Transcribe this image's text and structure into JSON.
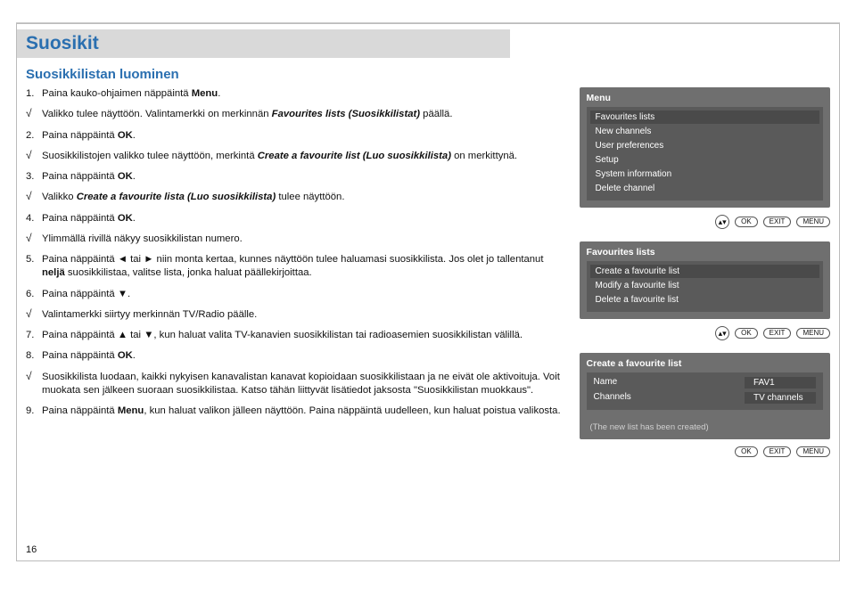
{
  "heading": "Suosikit",
  "section_title": "Suosikkilistan luominen",
  "steps": {
    "s1": {
      "num": "1.",
      "suffix": "."
    },
    "c1_prefix": "Valikko tulee näyttöön. Valintamerkki on merkinnän ",
    "c1_em": "Favourites lists (Suosikkilistat)",
    "c1_suffix": " päällä.",
    "s2": {
      "num": "2.",
      "suffix": "."
    },
    "c2_prefix": "Suosikkilistojen valikko tulee näyttöön, merkintä ",
    "c2_em": "Create a favourite list (Luo suosikkilista)",
    "c2_suffix": " on merkittynä.",
    "s3": {
      "num": "3.",
      "suffix": "."
    },
    "c3_prefix": "Valikko ",
    "c3_em": "Create a favourite lista (Luo suosikkilista)",
    "c3_suffix": " tulee näyttöön.",
    "s4": {
      "num": "4.",
      "suffix": "."
    },
    "c4": "Ylimmällä rivillä näkyy suosikkilistan numero.",
    "s5": {
      "num": "5."
    },
    "s5_text": " niin monta kertaa, kunnes näyttöön tulee haluamasi suosikkilista. Jos olet jo tallentanut ",
    "s5_em": "neljä",
    "s5_suffix": " suosikkilistaa, valitse lista, jonka haluat päällekirjoittaa.",
    "s6": {
      "num": "6.",
      "suffix": "."
    },
    "c6": "Valintamerkki siirtyy merkinnän TV/Radio päälle.",
    "s7": {
      "num": "7."
    },
    "s7_text": ", kun haluat valita TV-kanavien suosikkilistan tai radioasemien suosikkilistan välillä.",
    "s8": {
      "num": "8.",
      "suffix": "."
    },
    "c8": "Suosikkilista luodaan, kaikki nykyisen kanavalistan kanavat kopioidaan suosikkilistaan ja ne eivät ole aktivoituja. Voit muokata sen jälkeen suoraan suosikkilistaa. Katso tähän liittyvät lisätiedot jaksosta \"Suosikkilistan muokkaus\".",
    "s9": {
      "num": "9."
    },
    "s9_text": ", kun haluat valikon jälleen näyttöön. Paina näppäintä uudelleen, kun haluat poistua valikosta."
  },
  "labels": {
    "press_remote": "Paina kauko-ohjaimen näppäintä ",
    "press_btn": "Paina näppäintä ",
    "menu": "Menu",
    "ok": "OK",
    "tai": " tai ",
    "left": "◄",
    "right": "►",
    "up": "▲",
    "down": "▼",
    "exit": "EXIT",
    "menu_pill": "MENU",
    "updown": "▴▾"
  },
  "panel_menu": {
    "title": "Menu",
    "items": [
      "Favourites lists",
      "New channels",
      "User preferences",
      "Setup",
      "System information",
      "Delete channel"
    ]
  },
  "panel_fav": {
    "title": "Favourites lists",
    "items": [
      "Create a favourite list",
      "Modify a favourite list",
      "Delete a favourite list"
    ]
  },
  "panel_create": {
    "title": "Create a favourite list",
    "row_name_k": "Name",
    "row_name_v": "FAV1",
    "row_ch_k": "Channels",
    "row_ch_v": "TV channels",
    "note": "(The new list has been created)"
  },
  "page_number": "16"
}
